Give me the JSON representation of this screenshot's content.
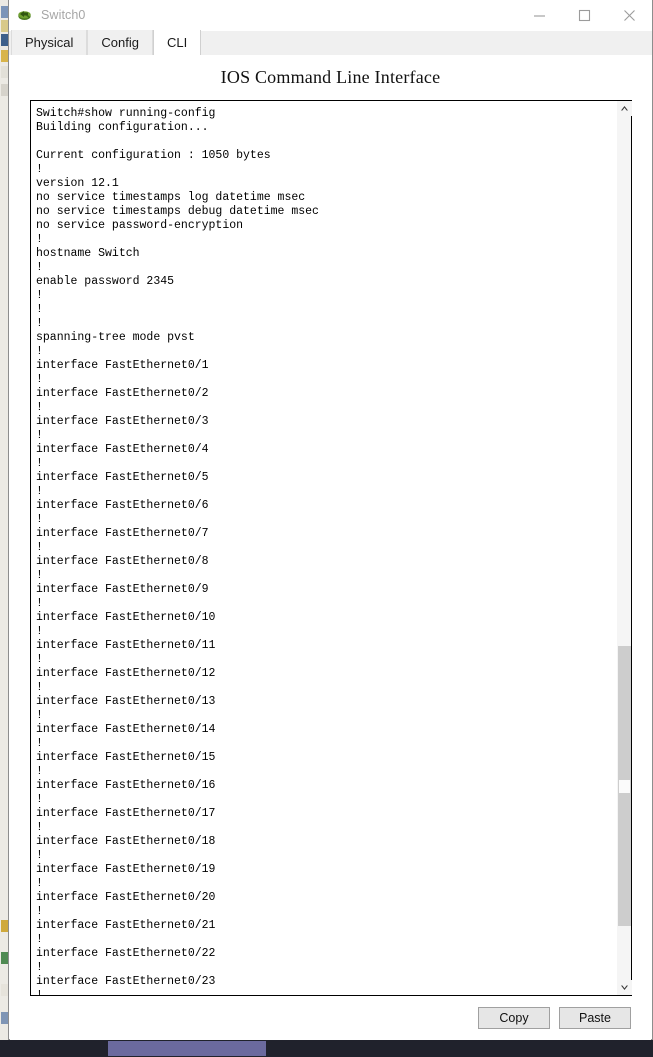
{
  "window": {
    "title": "Switch0",
    "icon": "switch-device-icon",
    "controls": {
      "minimize": "minimize-icon",
      "maximize": "maximize-icon",
      "close": "close-icon"
    }
  },
  "tabs": [
    {
      "label": "Physical",
      "active": false
    },
    {
      "label": "Config",
      "active": false
    },
    {
      "label": "CLI",
      "active": true
    }
  ],
  "panel": {
    "title": "IOS Command Line Interface"
  },
  "terminal": {
    "content": "Switch#show running-config\nBuilding configuration...\n\nCurrent configuration : 1050 bytes\n!\nversion 12.1\nno service timestamps log datetime msec\nno service timestamps debug datetime msec\nno service password-encryption\n!\nhostname Switch\n!\nenable password 2345\n!\n!\n!\nspanning-tree mode pvst\n!\ninterface FastEthernet0/1\n!\ninterface FastEthernet0/2\n!\ninterface FastEthernet0/3\n!\ninterface FastEthernet0/4\n!\ninterface FastEthernet0/5\n!\ninterface FastEthernet0/6\n!\ninterface FastEthernet0/7\n!\ninterface FastEthernet0/8\n!\ninterface FastEthernet0/9\n!\ninterface FastEthernet0/10\n!\ninterface FastEthernet0/11\n!\ninterface FastEthernet0/12\n!\ninterface FastEthernet0/13\n!\ninterface FastEthernet0/14\n!\ninterface FastEthernet0/15\n!\ninterface FastEthernet0/16\n!\ninterface FastEthernet0/17\n!\ninterface FastEthernet0/18\n!\ninterface FastEthernet0/19\n!\ninterface FastEthernet0/20\n!\ninterface FastEthernet0/21\n!\ninterface FastEthernet0/22\n!\ninterface FastEthernet0/23\n!"
  },
  "scrollbar": {
    "up_arrow": "scroll-up-icon",
    "down_arrow": "scroll-down-icon"
  },
  "footer": {
    "copy_label": "Copy",
    "paste_label": "Paste"
  },
  "colors": {
    "tab_active_bg": "#ffffff",
    "tab_inactive_bg": "#f0f0f0",
    "terminal_bg": "#ffffff",
    "terminal_fg": "#000000",
    "title_fg": "#a6a6a6",
    "button_bg": "#e6e6e6",
    "scroll_thumb": "#cdcdcd",
    "taskbar_bg": "#20222c",
    "taskbar_active": "#6b6a9e"
  }
}
